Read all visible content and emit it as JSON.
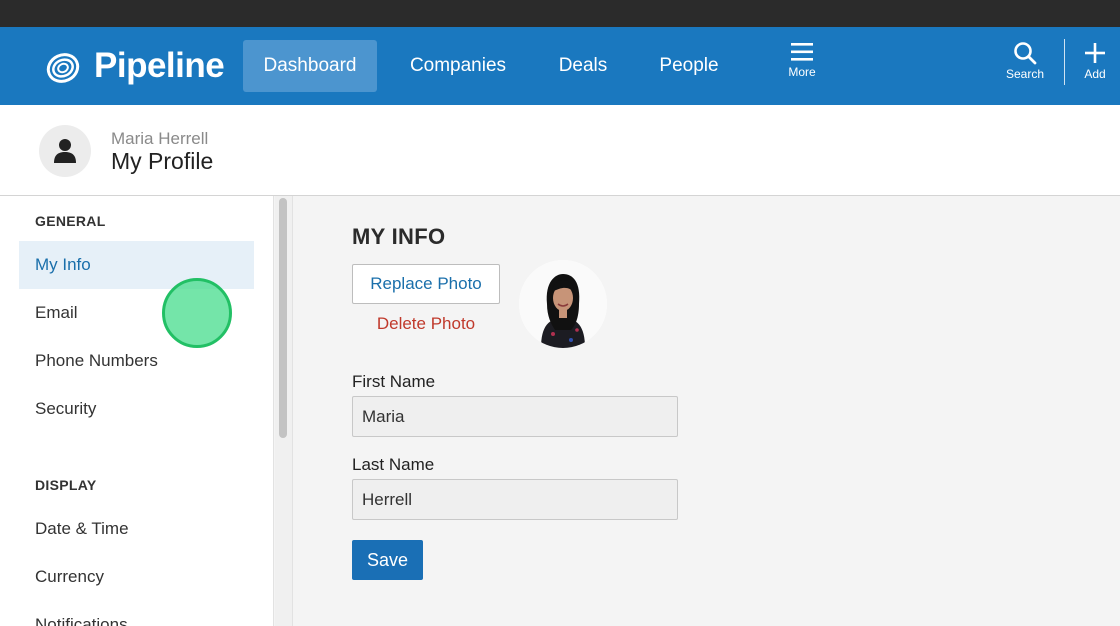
{
  "nav": {
    "brand": "Pipeline",
    "tabs": [
      {
        "label": "Dashboard",
        "active": true
      },
      {
        "label": "Companies"
      },
      {
        "label": "Deals"
      },
      {
        "label": "People"
      }
    ],
    "more_label": "More",
    "search_label": "Search",
    "add_label": "Add"
  },
  "header": {
    "user_name": "Maria Herrell",
    "title": "My Profile"
  },
  "sidebar": {
    "sections": [
      {
        "title": "GENERAL",
        "items": [
          "My Info",
          "Email",
          "Phone Numbers",
          "Security"
        ]
      },
      {
        "title": "DISPLAY",
        "items": [
          "Date & Time",
          "Currency",
          "Notifications"
        ]
      }
    ],
    "active_item": "My Info"
  },
  "main": {
    "section_title": "MY INFO",
    "replace_photo_label": "Replace Photo",
    "delete_photo_label": "Delete Photo",
    "first_name_label": "First Name",
    "first_name_value": "Maria",
    "last_name_label": "Last Name",
    "last_name_value": "Herrell",
    "save_label": "Save"
  },
  "colors": {
    "brand_blue": "#1a78bf",
    "active_tab": "#4c95cf",
    "link_blue": "#1a6fab",
    "delete_red": "#c0392b",
    "save_blue": "#1a6fb5",
    "click_marker": "#22c065"
  }
}
